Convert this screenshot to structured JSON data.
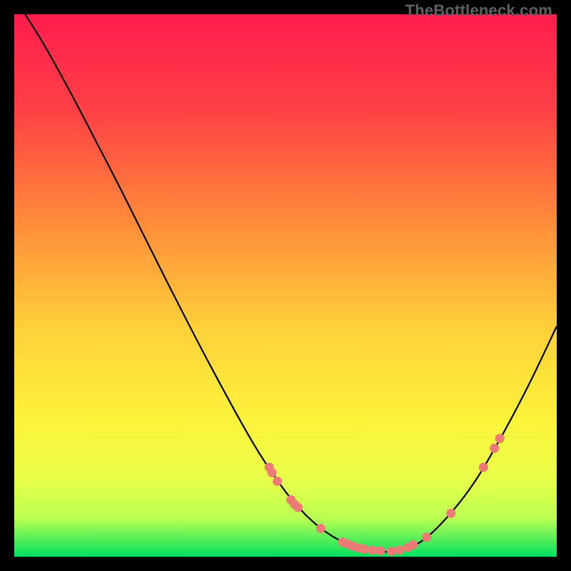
{
  "watermark": "TheBottleneck.com",
  "chart_data": {
    "type": "line",
    "title": "",
    "xlabel": "",
    "ylabel": "",
    "xlim": [
      0,
      100
    ],
    "ylim": [
      0,
      100
    ],
    "gradient_stops": [
      {
        "offset": 0,
        "color": "#ff1d4d"
      },
      {
        "offset": 18,
        "color": "#ff4146"
      },
      {
        "offset": 38,
        "color": "#ff8a3a"
      },
      {
        "offset": 58,
        "color": "#ffd13a"
      },
      {
        "offset": 75,
        "color": "#fcf33b"
      },
      {
        "offset": 86,
        "color": "#e8ff4a"
      },
      {
        "offset": 93,
        "color": "#b9ff52"
      },
      {
        "offset": 100,
        "color": "#00e060"
      }
    ],
    "curve": [
      {
        "x": 2.0,
        "y": 100.0
      },
      {
        "x": 6.0,
        "y": 93.5
      },
      {
        "x": 12.0,
        "y": 82.5
      },
      {
        "x": 20.0,
        "y": 67.0
      },
      {
        "x": 28.0,
        "y": 51.0
      },
      {
        "x": 36.0,
        "y": 35.5
      },
      {
        "x": 44.0,
        "y": 21.0
      },
      {
        "x": 50.0,
        "y": 12.0
      },
      {
        "x": 55.0,
        "y": 6.5
      },
      {
        "x": 60.0,
        "y": 3.0
      },
      {
        "x": 65.0,
        "y": 1.3
      },
      {
        "x": 70.0,
        "y": 1.0
      },
      {
        "x": 75.0,
        "y": 2.8
      },
      {
        "x": 80.0,
        "y": 7.5
      },
      {
        "x": 85.0,
        "y": 14.0
      },
      {
        "x": 90.0,
        "y": 22.5
      },
      {
        "x": 95.0,
        "y": 32.0
      },
      {
        "x": 100.0,
        "y": 42.5
      }
    ],
    "markers": [
      {
        "x": 47.0,
        "y": 16.5
      },
      {
        "x": 47.5,
        "y": 15.5
      },
      {
        "x": 48.5,
        "y": 13.9
      },
      {
        "x": 51.0,
        "y": 10.5
      },
      {
        "x": 51.7,
        "y": 9.6
      },
      {
        "x": 52.3,
        "y": 9.1
      },
      {
        "x": 56.5,
        "y": 5.2
      },
      {
        "x": 60.5,
        "y": 2.7
      },
      {
        "x": 61.5,
        "y": 2.3
      },
      {
        "x": 62.5,
        "y": 1.9
      },
      {
        "x": 63.5,
        "y": 1.6
      },
      {
        "x": 64.5,
        "y": 1.4
      },
      {
        "x": 66.0,
        "y": 1.2
      },
      {
        "x": 67.5,
        "y": 1.1
      },
      {
        "x": 69.5,
        "y": 1.0
      },
      {
        "x": 71.0,
        "y": 1.2
      },
      {
        "x": 72.5,
        "y": 1.7
      },
      {
        "x": 73.5,
        "y": 2.2
      },
      {
        "x": 76.0,
        "y": 3.6
      },
      {
        "x": 80.5,
        "y": 8.0
      },
      {
        "x": 86.5,
        "y": 16.5
      },
      {
        "x": 88.5,
        "y": 20.0
      },
      {
        "x": 89.5,
        "y": 21.8
      }
    ],
    "marker_color": "#ed7b75",
    "marker_radius": 6.5
  }
}
